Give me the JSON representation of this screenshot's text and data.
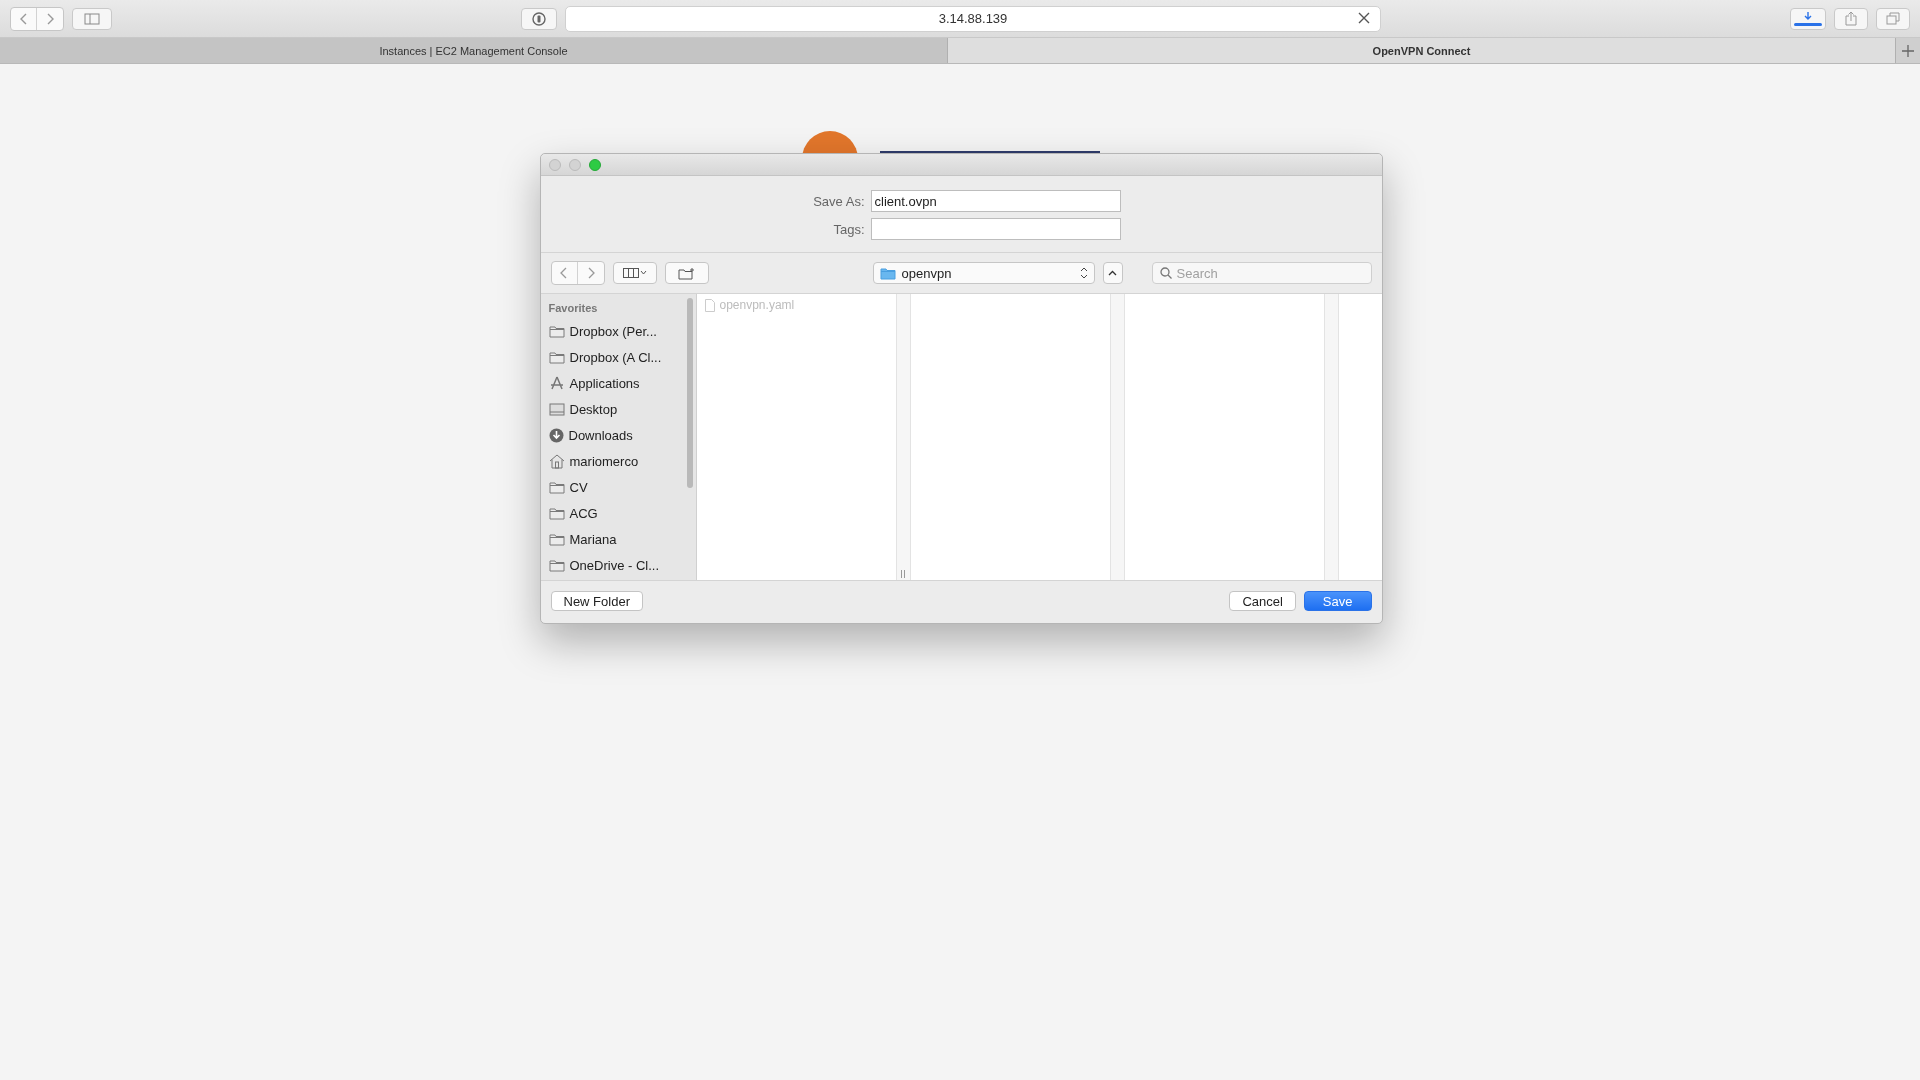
{
  "browser": {
    "url": "3.14.88.139",
    "tabs": [
      {
        "label": "Instances | EC2 Management Console",
        "selected": false
      },
      {
        "label": "OpenVPN Connect",
        "selected": true
      }
    ]
  },
  "dialog": {
    "save_as": {
      "label": "Save As:",
      "value": "client.ovpn"
    },
    "tags": {
      "label": "Tags:"
    },
    "location": "openvpn",
    "search": {
      "placeholder": "Search"
    },
    "sidebar": {
      "heading": "Favorites",
      "items": [
        {
          "label": "Dropbox (Per...",
          "kind": "folder"
        },
        {
          "label": "Dropbox (A Cl...",
          "kind": "folder"
        },
        {
          "label": "Applications",
          "kind": "applications"
        },
        {
          "label": "Desktop",
          "kind": "desktop"
        },
        {
          "label": "Downloads",
          "kind": "downloads"
        },
        {
          "label": "mariomerco",
          "kind": "home"
        },
        {
          "label": "CV",
          "kind": "folder"
        },
        {
          "label": "ACG",
          "kind": "folder"
        },
        {
          "label": "Mariana",
          "kind": "folder"
        },
        {
          "label": "OneDrive - Cl...",
          "kind": "folder"
        }
      ]
    },
    "files": [
      {
        "name": "openvpn.yaml",
        "disabled": true
      }
    ],
    "buttons": [
      {
        "label": "New Folder",
        "kind": "secondary"
      },
      {
        "label": "Cancel",
        "kind": "secondary"
      },
      {
        "label": "Save",
        "kind": "primary"
      }
    ]
  }
}
